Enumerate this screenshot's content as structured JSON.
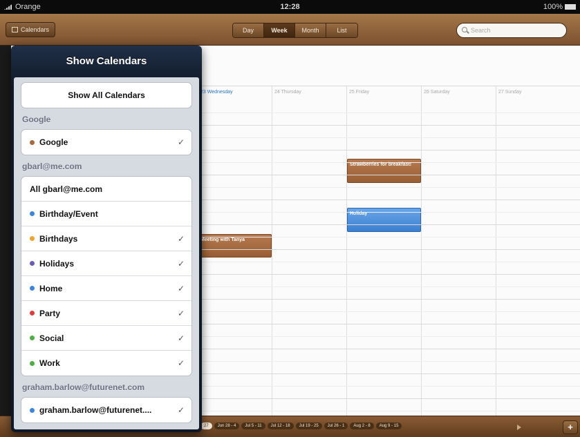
{
  "status_bar": {
    "carrier": "Orange",
    "time": "12:28",
    "battery": "100%"
  },
  "toolbar": {
    "calendars_label": "Calendars",
    "views": [
      "Day",
      "Week",
      "Month",
      "List"
    ],
    "search_placeholder": "Search"
  },
  "week": {
    "days": [
      "23 Wednesday",
      "24 Thursday",
      "25 Friday",
      "26 Saturday",
      "27 Sunday"
    ],
    "events": [
      {
        "title": "Meeting with Tanya",
        "color": "brown"
      },
      {
        "title": "Strawberries for breakfast!",
        "color": "brown"
      },
      {
        "title": "Holiday",
        "color": "blue"
      }
    ]
  },
  "bottom_bar": {
    "weeks": [
      "27",
      "Jun 28 - 4",
      "Jul 5 - 11",
      "Jul 12 - 18",
      "Jul 19 - 25",
      "Jul 26 - 1",
      "Aug 2 - 8",
      "Aug 9 - 15"
    ],
    "add_label": "+"
  },
  "popover": {
    "title": "Show Calendars",
    "show_all": "Show All Calendars",
    "sections": [
      {
        "label": "Google",
        "items": [
          {
            "label": "Google",
            "color": "#a86a3c",
            "checked": true
          }
        ]
      },
      {
        "label": "gbarl@me.com",
        "items": [
          {
            "label": "All gbarl@me.com",
            "color": null,
            "checked": false
          },
          {
            "label": "Birthday/Event",
            "color": "#3a86dd",
            "checked": false
          },
          {
            "label": "Birthdays",
            "color": "#f0a330",
            "checked": true
          },
          {
            "label": "Holidays",
            "color": "#6d5bb5",
            "checked": true
          },
          {
            "label": "Home",
            "color": "#3a86dd",
            "checked": true
          },
          {
            "label": "Party",
            "color": "#e03a3a",
            "checked": true
          },
          {
            "label": "Social",
            "color": "#4caf40",
            "checked": true
          },
          {
            "label": "Work",
            "color": "#4caf40",
            "checked": true
          }
        ]
      },
      {
        "label": "graham.barlow@futurenet.com",
        "items": [
          {
            "label": "graham.barlow@futurenet....",
            "color": "#3a86dd",
            "checked": true
          }
        ]
      }
    ],
    "check_glyph": "✓"
  }
}
